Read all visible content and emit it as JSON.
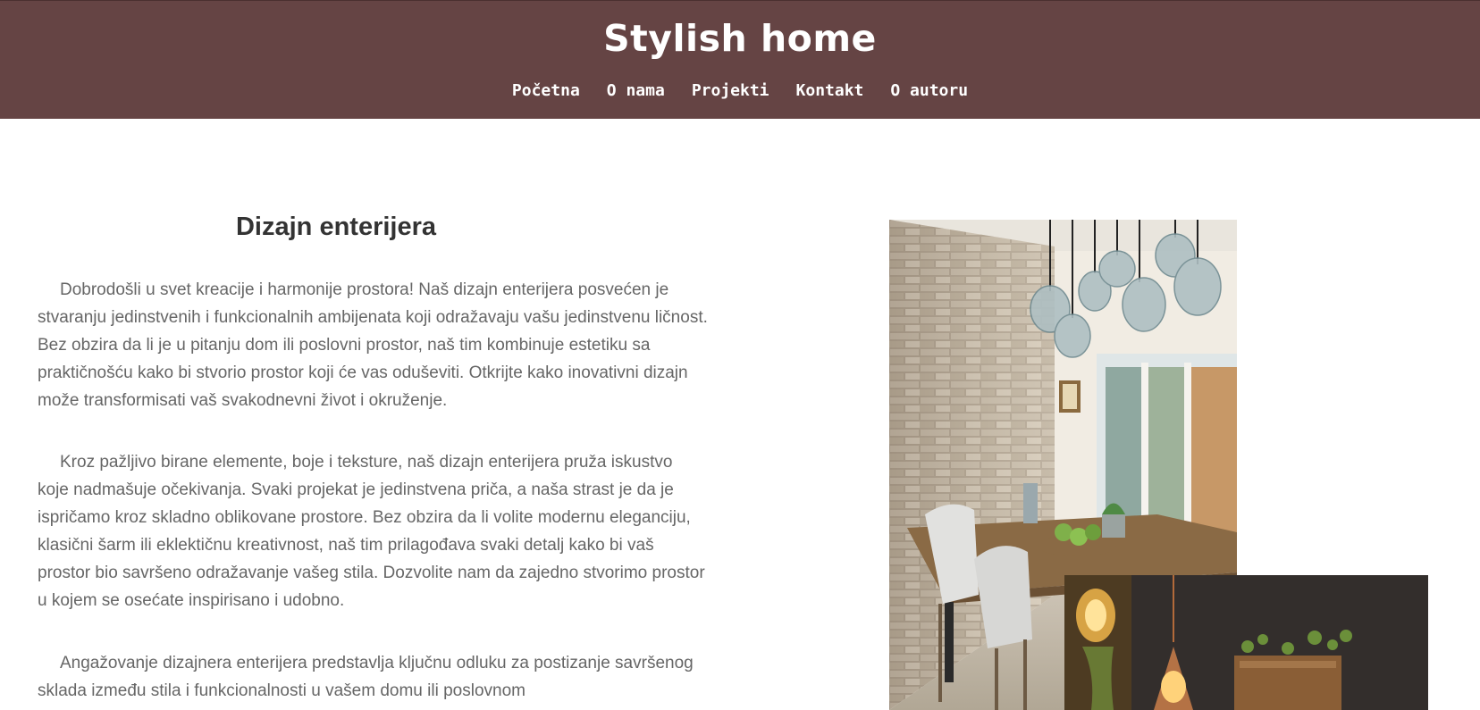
{
  "header": {
    "site_title": "Stylish home",
    "nav_items": [
      "Početna",
      "O nama",
      "Projekti",
      "Kontakt",
      "O autoru"
    ]
  },
  "main": {
    "heading": "Dizajn enterijera",
    "paragraphs": [
      "Dobrodošli u svet kreacije i harmonije prostora! Naš dizajn enterijera posvećen je stvaranju jedinstvenih i funkcionalnih ambijenata koji odražavaju vašu jedinstvenu ličnost. Bez obzira da li je u pitanju dom ili poslovni prostor, naš tim kombinuje estetiku sa praktičnošću kako bi stvorio prostor koji će vas oduševiti. Otkrijte kako inovativni dizajn može transformisati vaš svakodnevni život i okruženje.",
      "Kroz pažljivo birane elemente, boje i teksture, naš dizajn enterijera pruža iskustvo koje nadmašuje očekivanja. Svaki projekat je jedinstvena priča, a naša strast je da je ispričamo kroz skladno oblikovane prostore. Bez obzira da li volite modernu eleganciju, klasični šarm ili eklektičnu kreativnost, naš tim prilagođava svaki detalj kako bi vaš prostor bio savršeno odražavanje vašeg stila. Dozvolite nam da zajedno stvorimo prostor u kojem se osećate inspirisano i udobno.",
      "Angažovanje dizajnera enterijera predstavlja ključnu odluku za postizanje savršenog sklada između stila i funkcionalnosti u vašem domu ili poslovnom"
    ]
  },
  "colors": {
    "header_bg": "#654444",
    "header_text": "#ffffff",
    "heading_text": "#333333",
    "body_text": "#666666"
  }
}
